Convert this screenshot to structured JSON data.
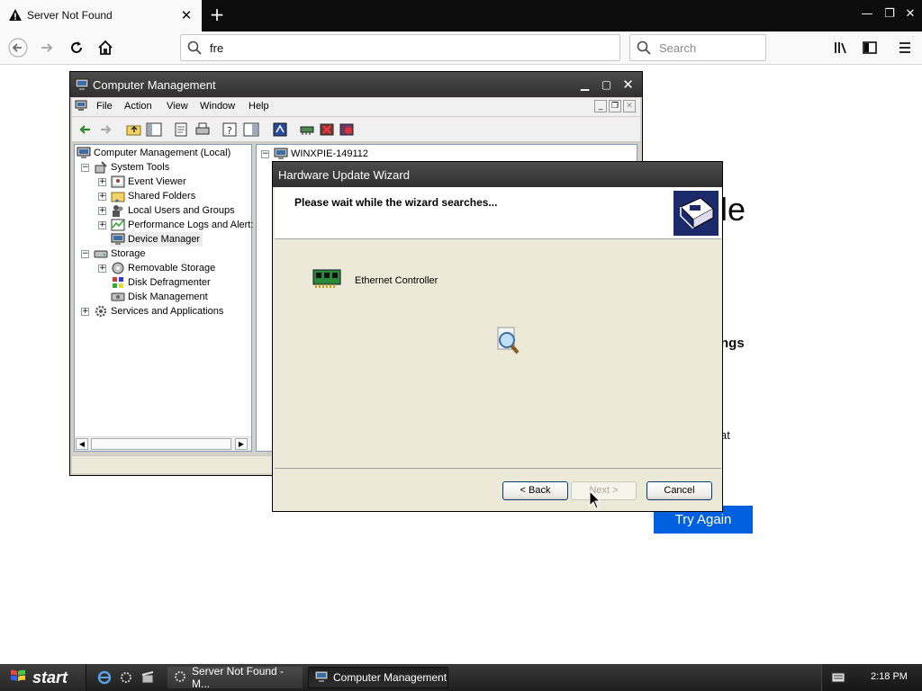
{
  "browser": {
    "tab_title": "Server Not Found",
    "url_value": "fre",
    "search_placeholder": "Search"
  },
  "error_page": {
    "title_fragment": "le",
    "settings_fragment": "ngs",
    "text_fragment": "at",
    "try_again": "Try Again"
  },
  "computer_management": {
    "title": "Computer Management",
    "menu": [
      "File",
      "Action",
      "View",
      "Window",
      "Help"
    ],
    "tree": {
      "root": "Computer Management (Local)",
      "system_tools": "System Tools",
      "event_viewer": "Event Viewer",
      "shared_folders": "Shared Folders",
      "local_users": "Local Users and Groups",
      "perf_logs": "Performance Logs and Alert:",
      "device_manager": "Device Manager",
      "storage": "Storage",
      "removable_storage": "Removable Storage",
      "disk_defrag": "Disk Defragmenter",
      "disk_management": "Disk Management",
      "services": "Services and Applications"
    },
    "right_root": "WINXPIE-149112"
  },
  "wizard": {
    "title": "Hardware Update Wizard",
    "heading": "Please wait while the wizard searches...",
    "device": "Ethernet Controller",
    "back": "< Back",
    "next": "Next >",
    "cancel": "Cancel"
  },
  "taskbar": {
    "start": "start",
    "items": [
      "Server Not Found - M...",
      "Computer Management"
    ],
    "clock": "2:18 PM"
  },
  "colors": {
    "try_again_bg": "#0060df",
    "xp_title_bg": "#3a3a3a",
    "taskbar_bg": "#2a2a2a"
  }
}
